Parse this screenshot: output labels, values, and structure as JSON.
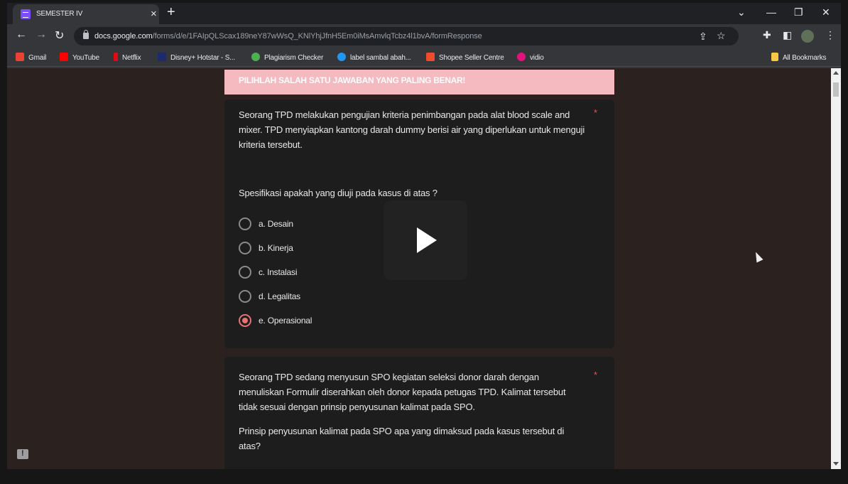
{
  "browser": {
    "tab_title": "SEMESTER IV",
    "url_host": "docs.google.com",
    "url_path": "/forms/d/e/1FAIpQLScax189neY87wWsQ_KNlYhjJfnH5Em0iMsAmvlqTcbz4l1bvA/formResponse",
    "all_bookmarks_label": "All Bookmarks"
  },
  "bookmarks": [
    {
      "label": "Gmail",
      "color": "#ea4335"
    },
    {
      "label": "YouTube",
      "color": "#ff0000"
    },
    {
      "label": "Netflix",
      "color": "#e50914"
    },
    {
      "label": "Disney+ Hotstar - S...",
      "color": "#1f2a6b"
    },
    {
      "label": "Plagiarism Checker",
      "color": "#4caf50"
    },
    {
      "label": "label sambal abah...",
      "color": "#2196f3"
    },
    {
      "label": "Shopee Seller Centre",
      "color": "#ee4d2d"
    },
    {
      "label": "vidio",
      "color": "#e3127a"
    }
  ],
  "form": {
    "section_header": "PILIHLAH SALAH SATU JAWABAN YANG PALING BENAR!",
    "questions": [
      {
        "text": "Seorang TPD melakukan pengujian kriteria penimbangan pada alat blood scale and mixer. TPD menyiapkan kantong darah dummy berisi air yang diperlukan untuk menguji kriteria tersebut.",
        "prompt": "Spesifikasi apakah yang diuji pada kasus di atas ?",
        "required_mark": "*",
        "options": [
          "a. Desain",
          "b. Kinerja",
          "c. Instalasi",
          "d. Legalitas",
          "e. Operasional"
        ],
        "selected_index": 4
      },
      {
        "text": "Seorang TPD sedang menyusun SPO kegiatan seleksi donor darah dengan menuliskan Formulir diserahkan oleh donor kepada petugas TPD. Kalimat tersebut tidak sesuai dengan prinsip penyusunan kalimat pada SPO.",
        "prompt": "Prinsip penyusunan kalimat pada SPO apa yang dimaksud pada kasus tersebut di atas?",
        "required_mark": "*"
      }
    ]
  },
  "colors": {
    "accent": "#e57373",
    "header_bg": "#f5b9c0",
    "page_bg": "#2b2220",
    "card_bg": "#1d1d1d"
  }
}
